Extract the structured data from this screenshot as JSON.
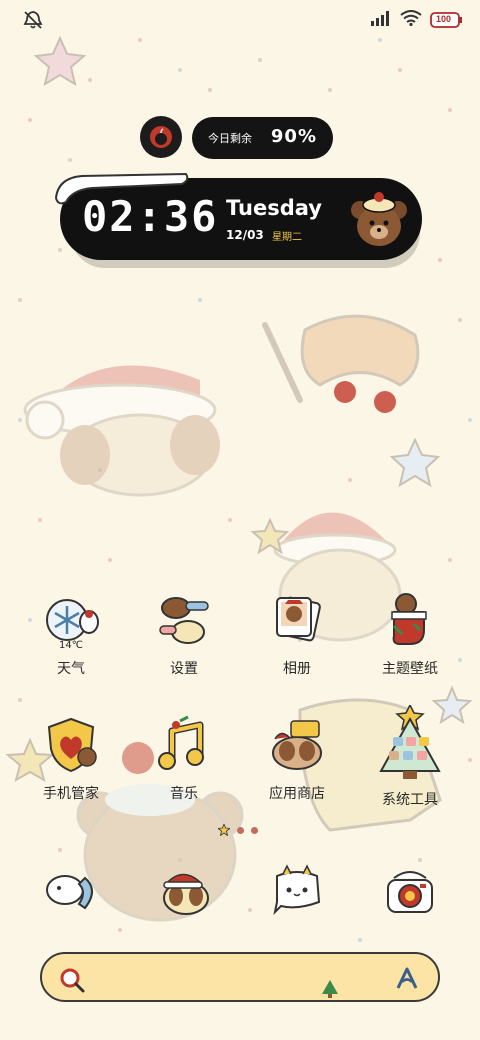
{
  "status_bar": {
    "icons": [
      "mute-icon",
      "signal-icon",
      "wifi-icon",
      "battery-icon"
    ],
    "battery_level": "100"
  },
  "battery_widget": {
    "label": "今日剩余",
    "value": "90%"
  },
  "clock_widget": {
    "time": "02:36",
    "day": "Tuesday",
    "date": "12/03",
    "weekday": "星期二"
  },
  "apps": [
    {
      "label": "天气",
      "icon": "weather-icon",
      "temp": "14℃"
    },
    {
      "label": "设置",
      "icon": "settings-icon"
    },
    {
      "label": "相册",
      "icon": "gallery-icon"
    },
    {
      "label": "主题壁纸",
      "icon": "themes-icon"
    },
    {
      "label": "手机管家",
      "icon": "security-icon"
    },
    {
      "label": "音乐",
      "icon": "music-icon"
    },
    {
      "label": "应用商店",
      "icon": "app-store-icon"
    },
    {
      "label": "系统工具",
      "icon": "tools-folder-icon"
    }
  ],
  "dock": [
    {
      "icon": "phone-icon"
    },
    {
      "icon": "contacts-icon"
    },
    {
      "icon": "messages-icon"
    },
    {
      "icon": "camera-icon"
    }
  ],
  "page_indicator": {
    "pages": 2,
    "current": 1
  },
  "colors": {
    "background": "#fbf6e6",
    "widget_dark": "#111111",
    "accent_red": "#c0392b",
    "accent_yellow": "#f3c748",
    "search_bar": "#fbe4a6"
  }
}
